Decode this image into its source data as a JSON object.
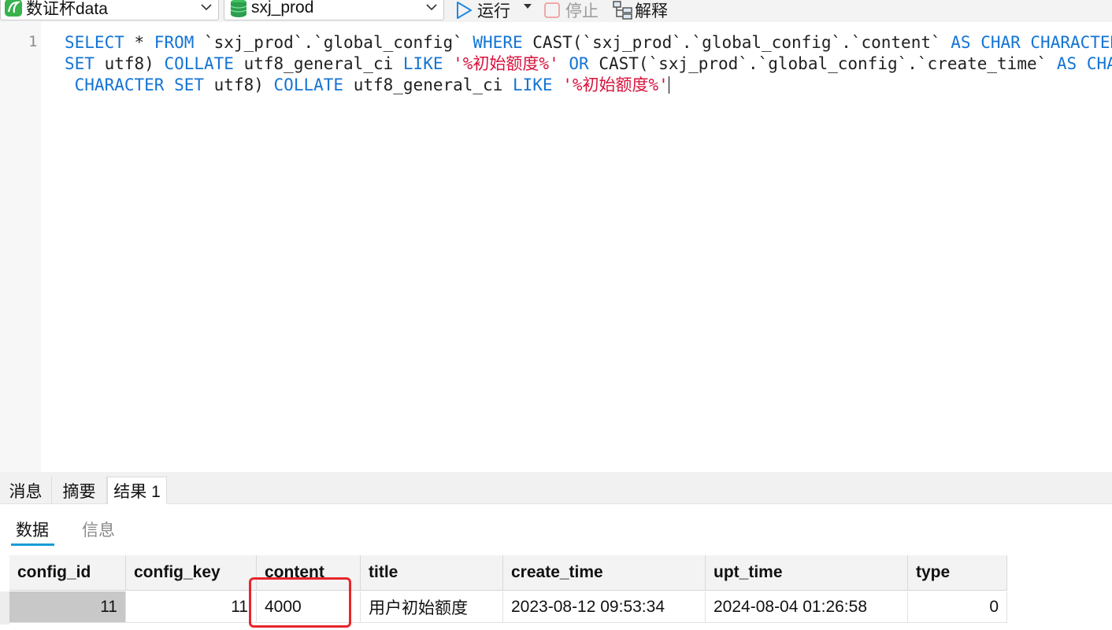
{
  "toolbar": {
    "connection": "数证杯data",
    "database": "sxj_prod",
    "run_label": "运行",
    "stop_label": "停止",
    "explain_label": "解释",
    "colors": {
      "run": "#1e88e5",
      "stop": "#f0a0a0",
      "db": "#2e9e4f",
      "conn": "#37b24d"
    }
  },
  "editor": {
    "line_number": "1",
    "line1": {
      "p1": "SELECT",
      "p2": " * ",
      "p3": "FROM",
      "p4": " `sxj_prod`.`global_config` ",
      "p5": "WHERE",
      "p6": " CAST(`sxj_prod`.`global_config`.`content` ",
      "p7": "AS CHAR CHARACTER"
    },
    "line2": {
      "p1": "SET",
      "p2": " utf8) ",
      "p3": "COLLATE",
      "p4": " utf8_general_ci ",
      "p5": "LIKE",
      "p6": " ",
      "p7": "'%初始额度%'",
      "p8": " ",
      "p9": "OR",
      "p10": " CAST(`sxj_prod`.`global_config`.`create_time` ",
      "p11": "AS CHAR"
    },
    "line3": {
      "p1": " CHARACTER SET",
      "p2": " utf8) ",
      "p3": "COLLATE",
      "p4": " utf8_general_ci ",
      "p5": "LIKE",
      "p6": " ",
      "p7": "'%初始额度%'"
    }
  },
  "result_tabs": [
    "消息",
    "摘要",
    "结果 1"
  ],
  "sub_tabs": [
    "数据",
    "信息"
  ],
  "table": {
    "columns": [
      "config_id",
      "config_key",
      "content",
      "title",
      "create_time",
      "upt_time",
      "type"
    ],
    "rows": [
      [
        "11",
        "11",
        "4000",
        "用户初始额度",
        "2023-08-12 09:53:34",
        "2024-08-04 01:26:58",
        "0"
      ]
    ]
  }
}
